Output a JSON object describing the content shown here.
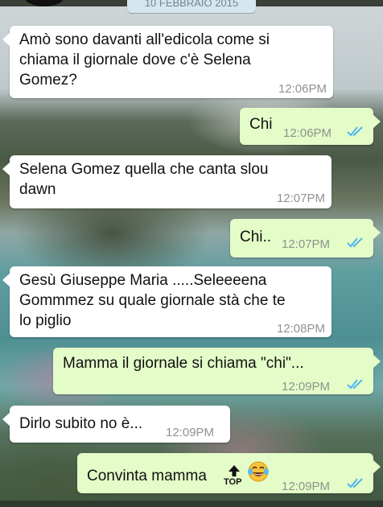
{
  "chat": {
    "date": "10 FEBBRAIO 2015",
    "messages": [
      {
        "direction": "in",
        "text_lines": [
          "Amò sono davanti all'edicola come si",
          "chiama il giornale dove c'è Selena",
          "Gomez?"
        ],
        "time": "12:06PM"
      },
      {
        "direction": "out",
        "text_lines": [
          "Chi"
        ],
        "time": "12:06PM",
        "status": "read"
      },
      {
        "direction": "in",
        "text_lines": [
          "Selena Gomez quella che canta slou",
          "dawn"
        ],
        "time": "12:07PM"
      },
      {
        "direction": "out",
        "text_lines": [
          "Chi.."
        ],
        "time": "12:07PM",
        "status": "read"
      },
      {
        "direction": "in",
        "text_lines": [
          "Gesù Giuseppe Maria .....Seleeeena",
          "Gommmez su quale giornale stà che te",
          "lo piglio"
        ],
        "time": "12:08PM"
      },
      {
        "direction": "out",
        "text_lines": [
          "Mamma il giornale si chiama \"chi\"..."
        ],
        "time": "12:09PM",
        "status": "read"
      },
      {
        "direction": "in",
        "text_lines": [
          "Dirlo subito no è..."
        ],
        "time": "12:09PM"
      },
      {
        "direction": "out",
        "text_lines": [
          "Convinta mamma"
        ],
        "time": "12:09PM",
        "status": "read",
        "emojis": [
          "top-arrow-emoji",
          "laughing-tears-emoji"
        ],
        "emoji_text": "TOP"
      }
    ]
  },
  "colors": {
    "incoming_bubble": "#ffffff",
    "outgoing_bubble": "#e4fcc8",
    "read_ticks": "#4fb6ec",
    "timestamp": "#8e9390"
  }
}
